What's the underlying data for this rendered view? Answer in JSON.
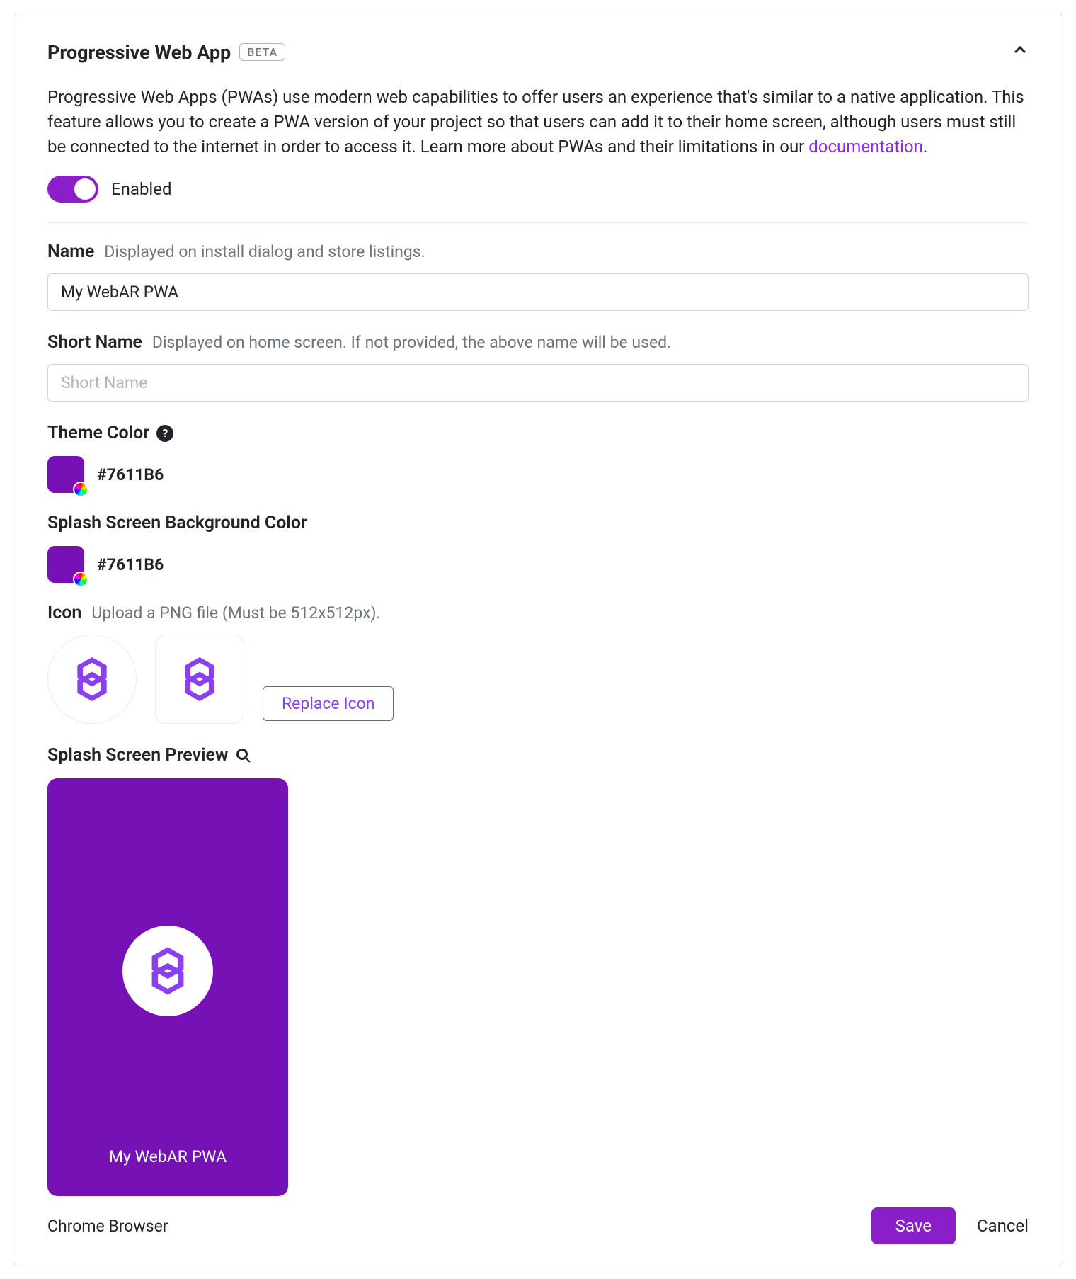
{
  "header": {
    "title": "Progressive Web App",
    "badge": "BETA"
  },
  "description_text": "Progressive Web Apps (PWAs) use modern web capabilities to offer users an experience that's similar to a native application. This feature allows you to create a PWA version of your project so that users can add it to their home screen, although users must still be connected to the internet in order to access it. Learn more about PWAs and their limitations in our ",
  "description_link": "documentation",
  "description_tail": ".",
  "enabled_label": "Enabled",
  "name": {
    "label": "Name",
    "hint": "Displayed on install dialog and store listings.",
    "value": "My WebAR PWA"
  },
  "short_name": {
    "label": "Short Name",
    "hint": "Displayed on home screen. If not provided, the above name will be used.",
    "placeholder": "Short Name",
    "value": ""
  },
  "theme_color": {
    "label": "Theme Color",
    "hex": "#7611B6"
  },
  "splash_bg": {
    "label": "Splash Screen Background Color",
    "hex": "#7611B6"
  },
  "icon": {
    "label": "Icon",
    "hint": "Upload a PNG file (Must be 512x512px).",
    "replace_label": "Replace Icon"
  },
  "splash_preview": {
    "label": "Splash Screen Preview",
    "app_name": "My WebAR PWA",
    "caption": "Chrome Browser"
  },
  "actions": {
    "save": "Save",
    "cancel": "Cancel"
  },
  "colors": {
    "accent": "#8a1ec9",
    "icon_glyph": "#8a3ff0"
  }
}
